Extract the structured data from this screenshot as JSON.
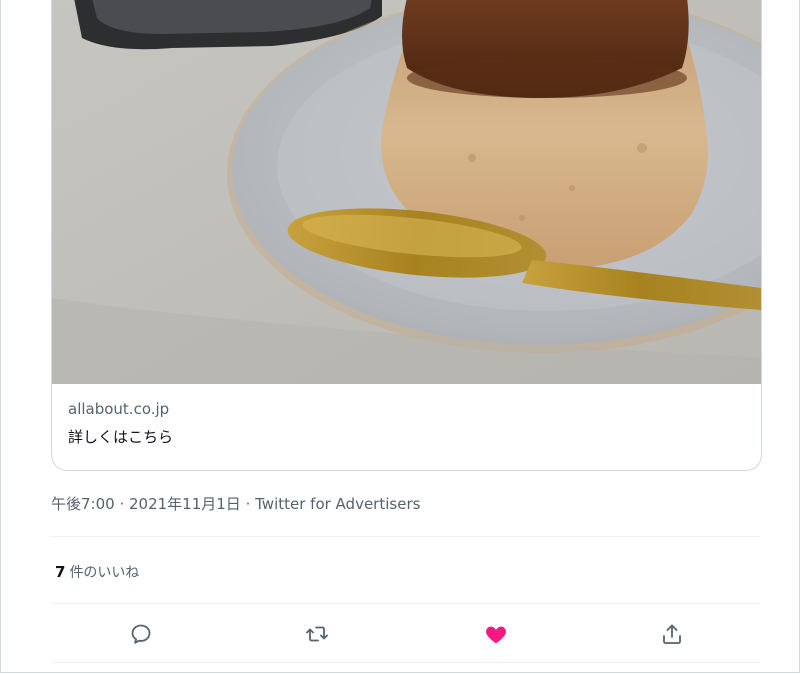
{
  "card": {
    "image_alt": "caramel pudding on a grey plate with a gold spoon",
    "domain": "allabout.co.jp",
    "title": "詳しくはこちら"
  },
  "tweet": {
    "time": "午後7:00",
    "separator": " · ",
    "date": "2021年11月1日",
    "source": "Twitter for Advertisers"
  },
  "stats": {
    "likes_count": "7",
    "likes_label": "件のいいね"
  },
  "actions": [
    {
      "name": "reply",
      "icon": "reply-icon"
    },
    {
      "name": "retweet",
      "icon": "retweet-icon"
    },
    {
      "name": "like",
      "icon": "heart-icon",
      "active": true
    },
    {
      "name": "share",
      "icon": "share-icon"
    }
  ],
  "colors": {
    "like_active": "#f91880",
    "secondary_text": "#536471",
    "icon": "#536471",
    "border": "#cfd9de"
  }
}
